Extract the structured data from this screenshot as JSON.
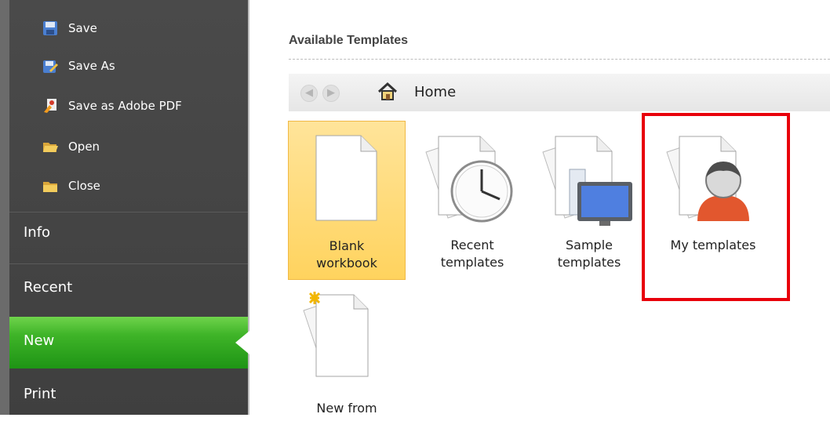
{
  "sidebar": {
    "commands": [
      {
        "label": "Save",
        "icon": "save-icon"
      },
      {
        "label": "Save As",
        "icon": "save-as-icon"
      },
      {
        "label": "Save as Adobe PDF",
        "icon": "adobe-pdf-icon"
      },
      {
        "label": "Open",
        "icon": "open-folder-icon"
      },
      {
        "label": "Close",
        "icon": "close-folder-icon"
      }
    ],
    "tabs": [
      {
        "label": "Info"
      },
      {
        "label": "Recent"
      },
      {
        "label": "New",
        "selected": true
      },
      {
        "label": "Print"
      }
    ]
  },
  "main": {
    "title": "Available Templates",
    "nav": {
      "back_icon": "back-arrow-icon",
      "forward_icon": "forward-arrow-icon",
      "home_icon": "home-icon",
      "location": "Home"
    },
    "templates": [
      {
        "label": "Blank\nworkbook",
        "icon": "blank-document-icon",
        "selected": true
      },
      {
        "label": "Recent\ntemplates",
        "icon": "clock-document-icon"
      },
      {
        "label": "Sample\ntemplates",
        "icon": "computer-document-icon"
      },
      {
        "label": "My templates",
        "icon": "user-document-icon",
        "highlighted": true
      },
      {
        "label": "New from",
        "icon": "new-document-sparkle-icon"
      }
    ]
  },
  "colors": {
    "sidebar_bg": "#444444",
    "selected_tab_green": "#3fb428",
    "selected_tile": "#ffd35e",
    "highlight_red": "#e8000b"
  }
}
